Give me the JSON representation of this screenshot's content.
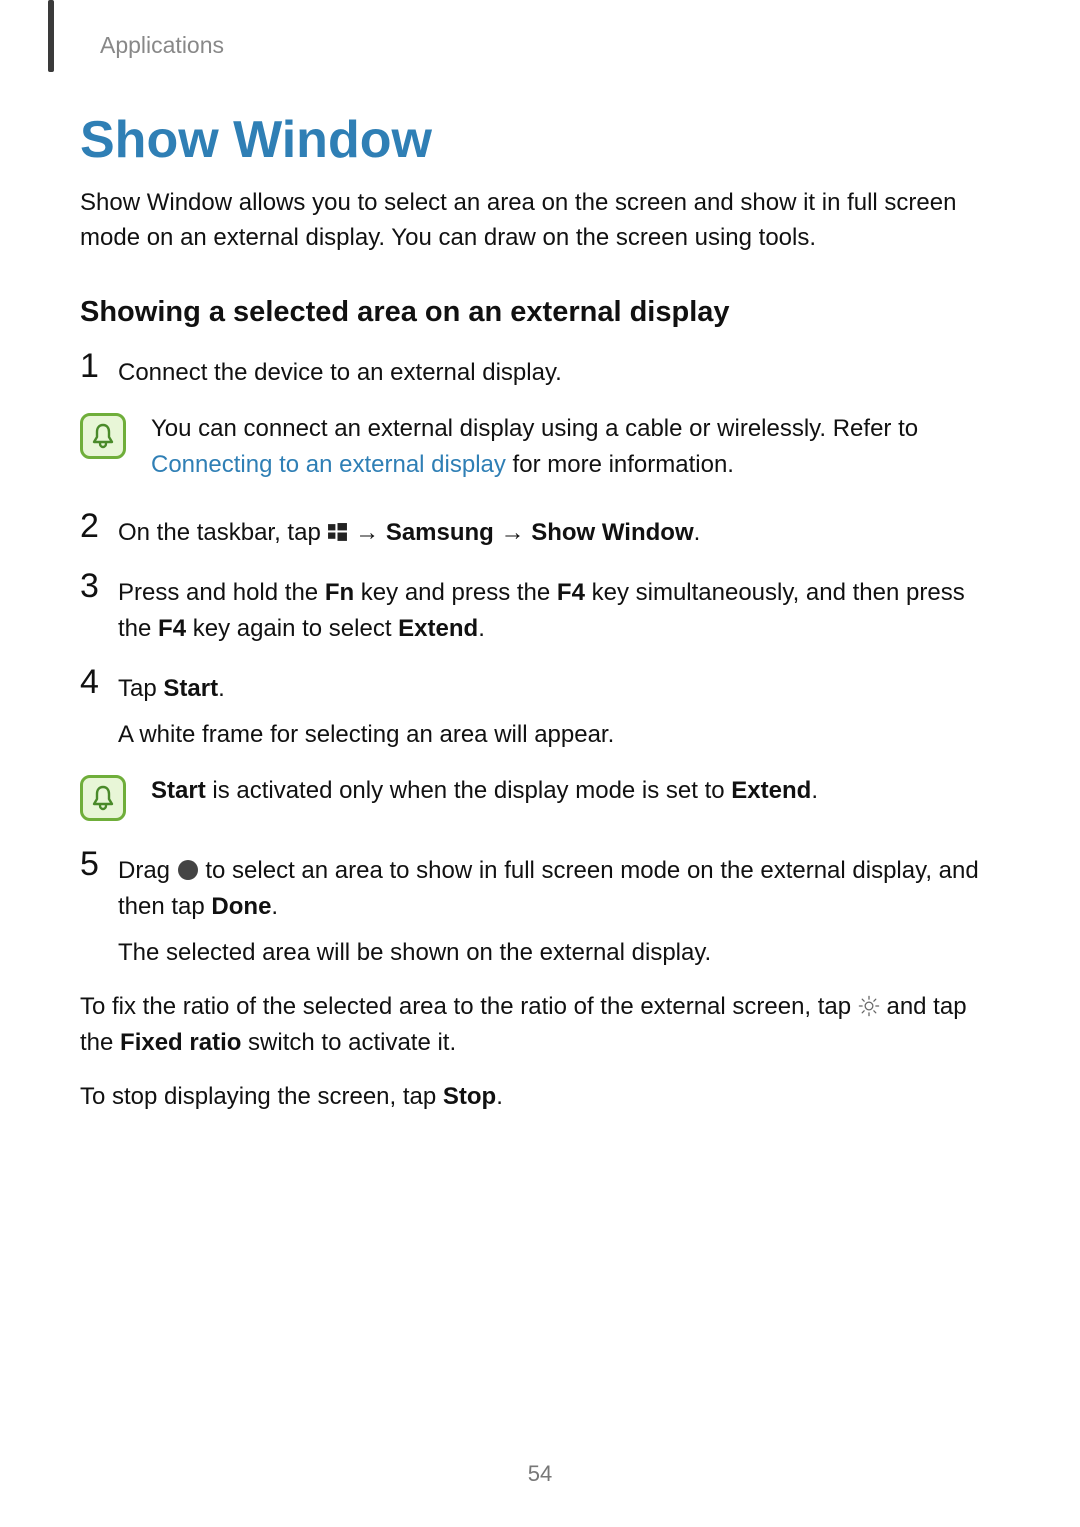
{
  "breadcrumb": "Applications",
  "title": "Show Window",
  "intro": "Show Window allows you to select an area on the screen and show it in full screen mode on an external display. You can draw on the screen using tools.",
  "subhead": "Showing a selected area on an external display",
  "steps": {
    "s1": {
      "num": "1",
      "text": "Connect the device to an external display."
    },
    "s2": {
      "num": "2",
      "pre": "On the taskbar, tap ",
      "arrow1": " → ",
      "bold1": "Samsung",
      "arrow2": " → ",
      "bold2": "Show Window",
      "post": "."
    },
    "s3": {
      "num": "3",
      "t1": "Press and hold the ",
      "b1": "Fn",
      "t2": " key and press the ",
      "b2": "F4",
      "t3": " key simultaneously, and then press the ",
      "b3": "F4",
      "t4": " key again to select ",
      "b4": "Extend",
      "t5": "."
    },
    "s4": {
      "num": "4",
      "t1": "Tap ",
      "b1": "Start",
      "t2": ".",
      "sub": "A white frame for selecting an area will appear."
    },
    "s5": {
      "num": "5",
      "t1": "Drag ",
      "t2": " to select an area to show in full screen mode on the external display, and then tap ",
      "b1": "Done",
      "t3": ".",
      "sub": "The selected area will be shown on the external display."
    }
  },
  "notes": {
    "n1": {
      "t1": "You can connect an external display using a cable or wirelessly. Refer to ",
      "link": "Connecting to an external display",
      "t2": " for more information."
    },
    "n2": {
      "b1": "Start",
      "t1": " is activated only when the display mode is set to ",
      "b2": "Extend",
      "t2": "."
    }
  },
  "tail": {
    "p1": {
      "t1": "To fix the ratio of the selected area to the ratio of the external screen, tap ",
      "t2": " and tap the ",
      "b1": "Fixed ratio",
      "t3": " switch to activate it."
    },
    "p2": {
      "t1": "To stop displaying the screen, tap ",
      "b1": "Stop",
      "t2": "."
    }
  },
  "page_number": "54"
}
